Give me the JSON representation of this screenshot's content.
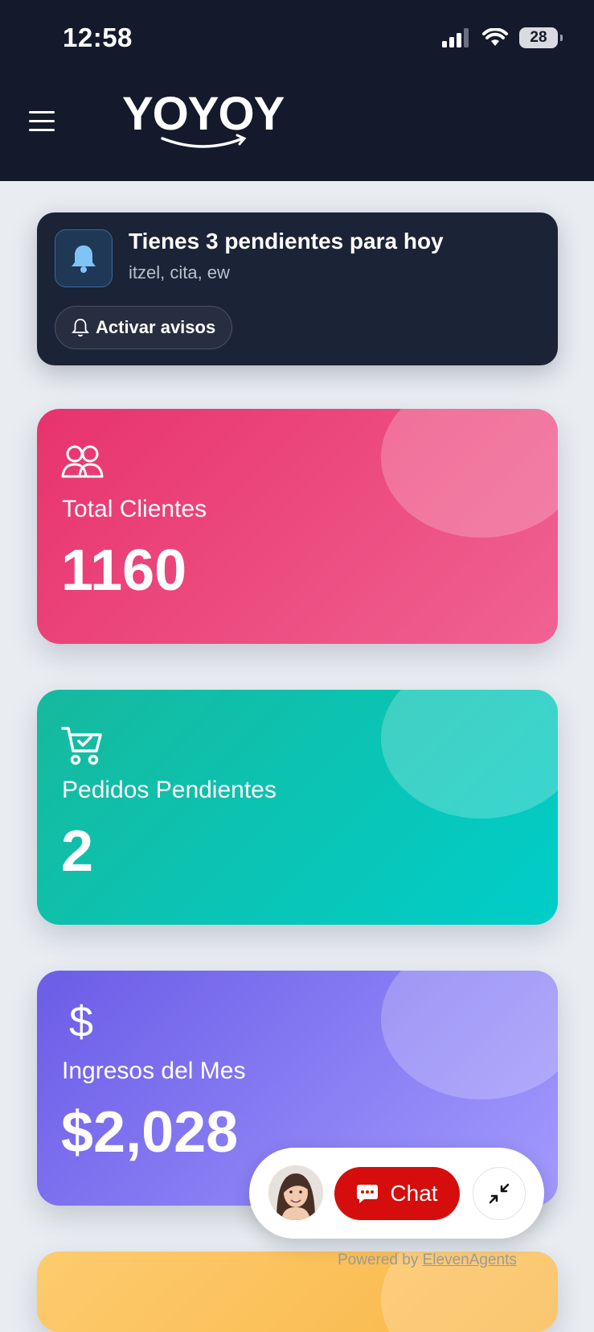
{
  "status_bar": {
    "time": "12:58",
    "battery": "28",
    "icons": [
      "signal-icon",
      "wifi-icon",
      "battery-icon"
    ]
  },
  "header": {
    "logo": "YOYOY",
    "menu_icon": "hamburger-icon"
  },
  "notice": {
    "title": "Tienes 3 pendientes para hoy",
    "subtitle": "itzel, cita, ew",
    "button_label": "Activar avisos",
    "icon": "bell-icon"
  },
  "cards": [
    {
      "label": "Total Clientes",
      "value": "1160",
      "icon": "users-icon",
      "color": "#e8336d"
    },
    {
      "label": "Pedidos Pendientes",
      "value": "2",
      "icon": "cart-check-icon",
      "color": "#16b99d"
    },
    {
      "label": "Ingresos del Mes",
      "value": "$2,028",
      "icon": "dollar-icon",
      "color": "#6c5ce7"
    },
    {
      "color": "#fdcb6e"
    }
  ],
  "chat_widget": {
    "chat_label": "Chat",
    "powered_prefix": "Powered by",
    "powered_link": "ElevenAgents",
    "accent": "#d50d0d"
  }
}
